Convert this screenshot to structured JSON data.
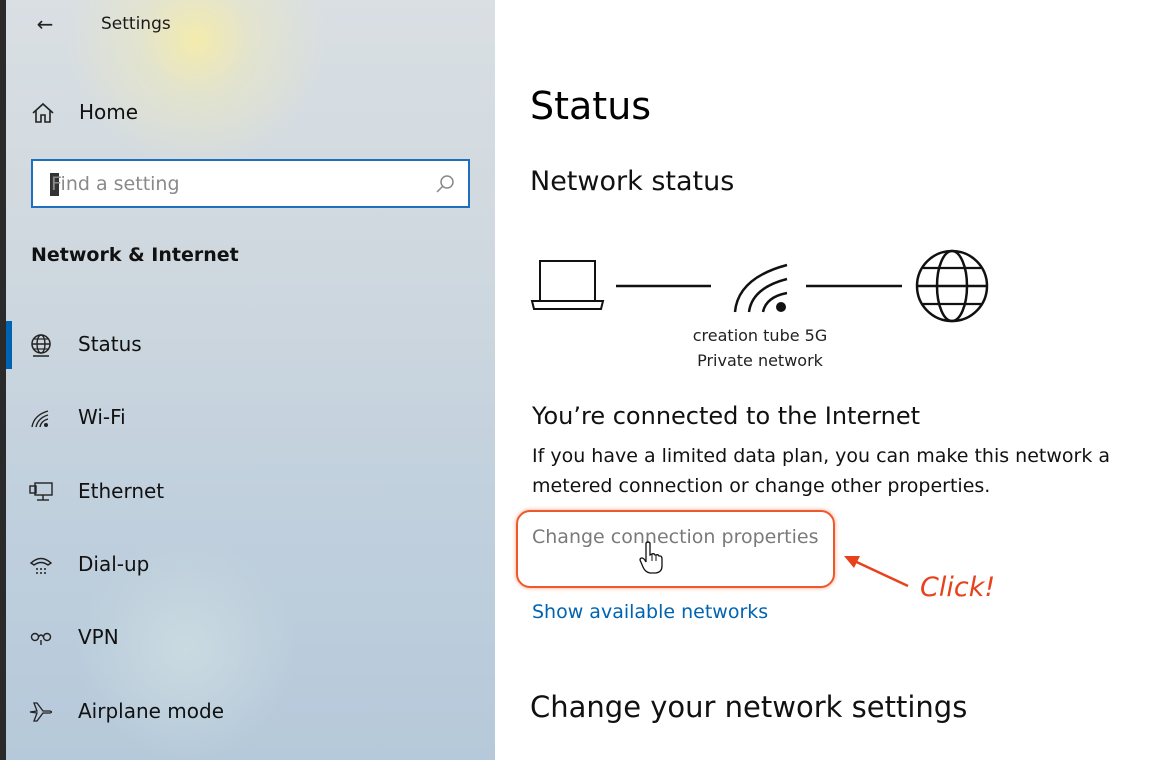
{
  "window": {
    "title": "Settings",
    "back_glyph": "←"
  },
  "sidebar": {
    "home_label": "Home",
    "search": {
      "placeholder": "Find a setting",
      "value": ""
    },
    "section_title": "Network & Internet",
    "items": [
      {
        "label": "Status",
        "icon": "globe-icon",
        "active": true
      },
      {
        "label": "Wi-Fi",
        "icon": "wifi-icon",
        "active": false
      },
      {
        "label": "Ethernet",
        "icon": "ethernet-icon",
        "active": false
      },
      {
        "label": "Dial-up",
        "icon": "dialup-icon",
        "active": false
      },
      {
        "label": "VPN",
        "icon": "vpn-icon",
        "active": false
      },
      {
        "label": "Airplane mode",
        "icon": "airplane-icon",
        "active": false
      }
    ],
    "accent": "#0063b1"
  },
  "main": {
    "title": "Status",
    "network_status_heading": "Network status",
    "network": {
      "name": "creation tube 5G",
      "type": "Private network"
    },
    "connected_title": "You’re connected to the Internet",
    "connected_description": "If you have a limited data plan, you can make this network a metered connection or change other properties.",
    "change_properties_link": "Change connection properties",
    "show_networks_link": "Show available networks",
    "change_settings_heading": "Change your network settings"
  },
  "annotation": {
    "label": "Click!",
    "color": "#e8421d"
  }
}
